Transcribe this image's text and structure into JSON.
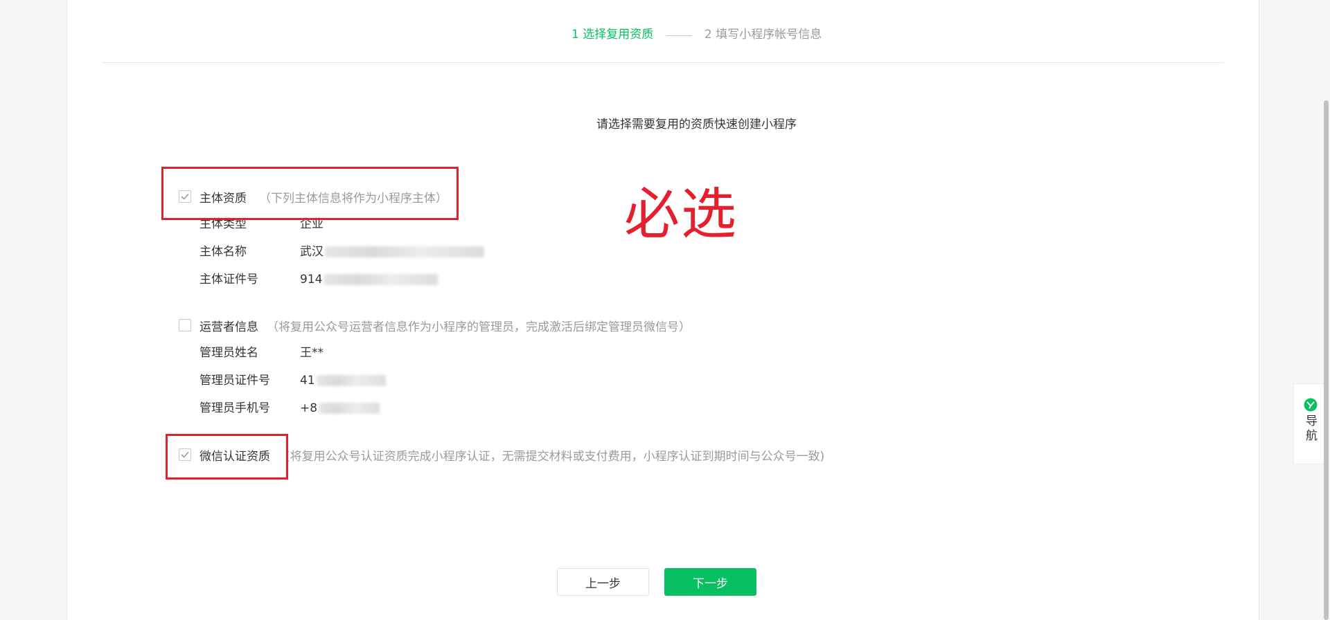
{
  "steps": {
    "step1": "1 选择复用资质",
    "step2": "2 填写小程序帐号信息"
  },
  "subtitle": "请选择需要复用的资质快速创建小程序",
  "entity": {
    "title": "主体资质",
    "desc": "（下列主体信息将作为小程序主体）",
    "checked": true,
    "rows": [
      {
        "label": "主体类型",
        "value": "企业"
      },
      {
        "label": "主体名称",
        "value": "武汉"
      },
      {
        "label": "主体证件号",
        "value": "914"
      }
    ]
  },
  "operator": {
    "title": "运营者信息",
    "desc": "（将复用公众号运营者信息作为小程序的管理员，完成激活后绑定管理员微信号）",
    "checked": false,
    "rows": [
      {
        "label": "管理员姓名",
        "value": "王**"
      },
      {
        "label": "管理员证件号",
        "value": "41"
      },
      {
        "label": "管理员手机号",
        "value": "+8"
      }
    ]
  },
  "wechat_cert": {
    "title": "微信认证资质",
    "desc": "(将复用公众号认证资质完成小程序认证，无需提交材料或支付费用，小程序认证到期时间与公众号一致)",
    "checked": true
  },
  "annotation": {
    "text": "必选",
    "color": "#e5202e"
  },
  "buttons": {
    "prev": "上一步",
    "next": "下一步"
  },
  "float_nav": {
    "label": "导航",
    "icon": "wechat-nav-icon"
  },
  "colors": {
    "accent": "#07c160",
    "annotation_red": "#e5202e",
    "muted_text": "#9a9a9a"
  }
}
